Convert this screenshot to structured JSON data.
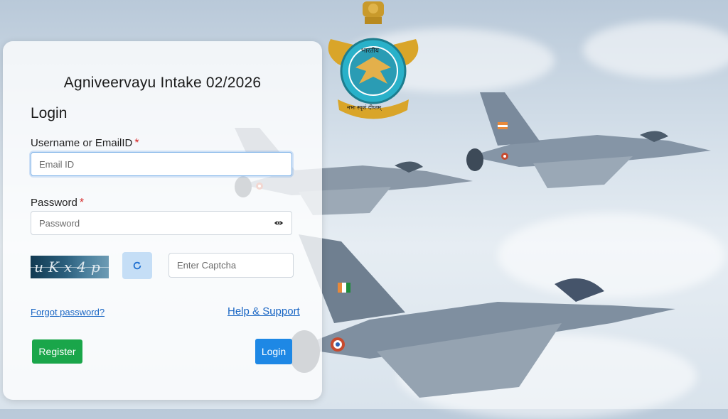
{
  "form": {
    "title": "Agniveervayu Intake 02/2026",
    "heading": "Login",
    "username": {
      "label": "Username or EmailID",
      "required_mark": "*",
      "placeholder": "Email ID",
      "value": ""
    },
    "password": {
      "label": "Password",
      "required_mark": "*",
      "placeholder": "Password",
      "value": "",
      "toggle_icon": "eye-icon"
    },
    "captcha": {
      "image_text": "uKx4p",
      "refresh_icon": "refresh-icon",
      "placeholder": "Enter Captcha",
      "value": ""
    },
    "links": {
      "forgot_password": "Forgot password?",
      "help_support": "Help & Support"
    },
    "buttons": {
      "register": "Register",
      "login": "Login"
    }
  },
  "emblem": {
    "top_text": "भारतीय",
    "ribbon_text": "नभः स्पृशं दीप्तम्",
    "name": "iaf-emblem"
  },
  "colors": {
    "register": "#1aa64a",
    "login": "#1e88e5",
    "link": "#1a66c4",
    "required": "#d62828",
    "refresh_bg": "#c5def6"
  }
}
